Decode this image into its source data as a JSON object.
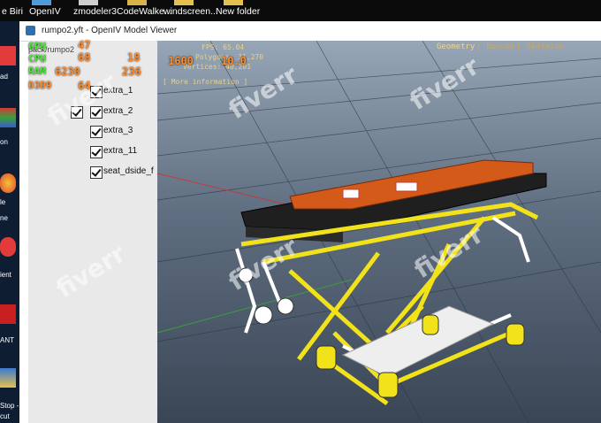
{
  "taskbar": {
    "items": [
      {
        "label": "e Biri"
      },
      {
        "label": "OpenIV"
      },
      {
        "label": "zmodeler3"
      },
      {
        "label": "CodeWalke..."
      },
      {
        "label": "windscreen..."
      },
      {
        "label": "New folder"
      }
    ]
  },
  "desktop_icons": [
    {
      "label": "ad"
    },
    {
      "label": "on"
    },
    {
      "label": "le"
    },
    {
      "label": "ne"
    },
    {
      "label": "ient"
    },
    {
      "label": "ANT"
    },
    {
      "label": "Stop -"
    },
    {
      "label": "cut"
    }
  ],
  "window": {
    "title": "rumpo2.yft - OpenIV Model Viewer"
  },
  "left_panel": {
    "header": "pack/rumpo2",
    "checkboxes": [
      {
        "label": "extra_1",
        "checked": true
      },
      {
        "label": "extra_2",
        "checked": true
      },
      {
        "label": "extra_3",
        "checked": true
      },
      {
        "label": "extra_11",
        "checked": true
      },
      {
        "label": "seat_dside_f",
        "checked": true
      }
    ]
  },
  "viewer": {
    "tabs": [
      "Geometry",
      "Bounds",
      "Skeleton"
    ],
    "active_tab": "Geometry",
    "fps": "FPS: 65.04",
    "polygons": "Polygons: 31,270",
    "vertices": "Vertices: 40,201",
    "more_info": "[ More information ]"
  },
  "hardware_overlay": {
    "gpu_label": "GPU",
    "cpu_label": "CPU",
    "ram_label": "RAM",
    "ram_value": "6230",
    "fps_label": "D3D9",
    "gpu_temp": "47",
    "cpu_temp": "68",
    "gpu_load": "18",
    "cpu_load": "236",
    "clock1": "1600",
    "clock2": "10.0",
    "vram": "64"
  },
  "watermark": "fiverr",
  "colors": {
    "taskbar": "#0b0b0b",
    "overlay_label": "#52e33e",
    "overlay_value": "#ff8a2a",
    "viewer_text": "#e6d18c"
  }
}
